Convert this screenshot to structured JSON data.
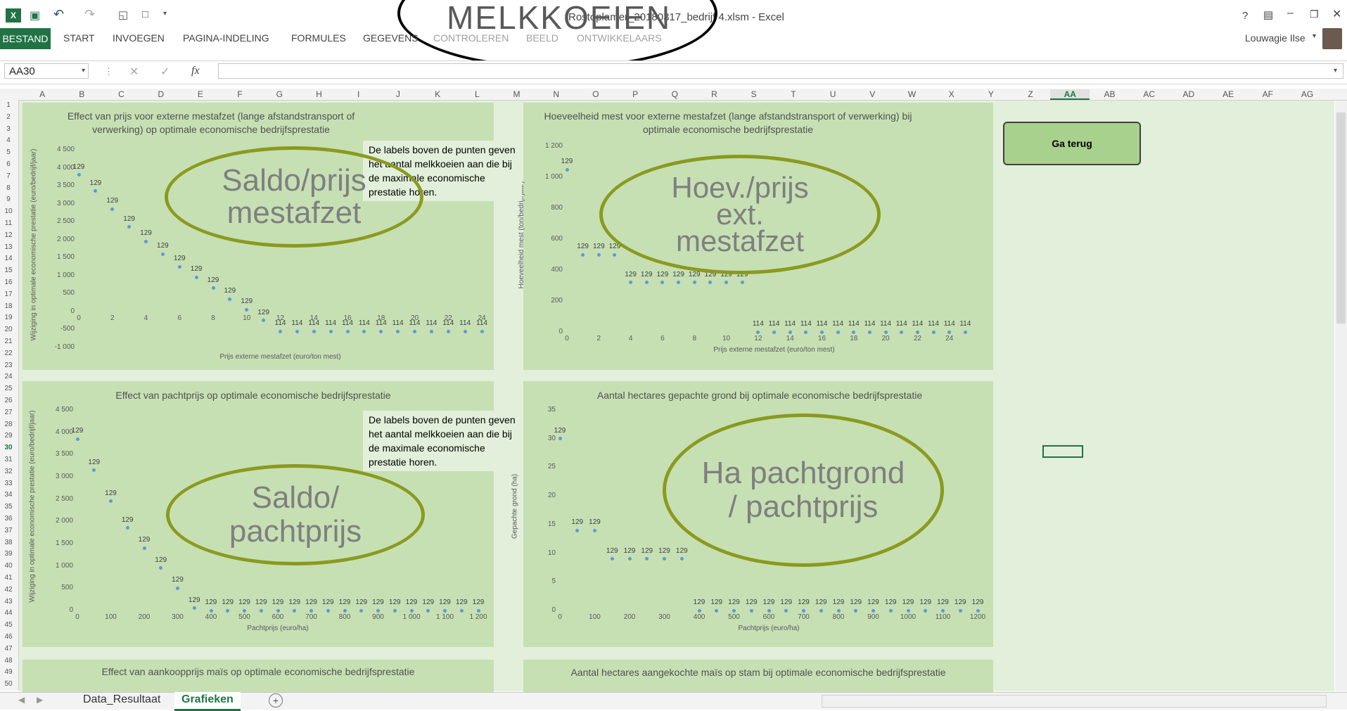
{
  "window": {
    "title": "Rostoplamer_20180317_bedrijf 4.xlsm - Excel",
    "overlay_label": "MELKKOEIEN",
    "user": "Louwagie Ilse",
    "help": "?"
  },
  "ribbon": {
    "tabs": [
      "BESTAND",
      "START",
      "INVOEGEN",
      "PAGINA-INDELING",
      "FORMULES",
      "GEGEVENS",
      "CONTROLEREN",
      "BEELD",
      "ONTWIKKELAARS"
    ]
  },
  "formula_bar": {
    "namebox": "AA30",
    "fx": "fx",
    "value": ""
  },
  "columns": [
    "A",
    "B",
    "C",
    "D",
    "E",
    "F",
    "G",
    "H",
    "I",
    "J",
    "K",
    "L",
    "M",
    "N",
    "O",
    "P",
    "Q",
    "R",
    "S",
    "T",
    "U",
    "V",
    "W",
    "X",
    "Y",
    "Z",
    "AA",
    "AB",
    "AC",
    "AD",
    "AE",
    "AF",
    "AG"
  ],
  "rows": [
    "1",
    "2",
    "3",
    "4",
    "5",
    "6",
    "7",
    "8",
    "9",
    "10",
    "11",
    "12",
    "13",
    "14",
    "15",
    "16",
    "17",
    "18",
    "19",
    "20",
    "21",
    "22",
    "23",
    "24",
    "25",
    "26",
    "27",
    "28",
    "29",
    "30",
    "31",
    "32",
    "33",
    "34",
    "35",
    "36",
    "37",
    "38",
    "39",
    "40",
    "41",
    "42",
    "43",
    "44",
    "45",
    "46",
    "47",
    "48",
    "49",
    "50"
  ],
  "note_text": "De labels boven de punten geven het aantal melkkoeien aan die bij de maximale economische prestatie horen.",
  "ellipses": {
    "e1": "Saldo/prijs mestafzet",
    "e2": "Hoev./prijs ext. mestafzet",
    "e3": "Saldo/ pachtprijs",
    "e4": "Ha pachtgrond / pachtprijs"
  },
  "button": {
    "label": "Ga terug"
  },
  "sheets": {
    "tab1": "Data_Resultaat",
    "tab2": "Grafieken",
    "add": "+"
  },
  "bottom_titles": {
    "t5": "Effect van aankoopprijs maïs op optimale economische bedrijfsprestatie",
    "t6": "Aantal hectares aangekochte maïs op stam bij optimale economische bedrijfsprestatie"
  },
  "chart_data": [
    {
      "type": "scatter",
      "title": "Effect van prijs voor externe mestafzet (lange afstandstransport of verwerking) op optimale economische bedrijfsprestatie",
      "xlabel": "Prijs externe mestafzet (euro/ton mest)",
      "ylabel": "Wijziging in optimale economische prestatie (euro/bedrijf/jaar)",
      "xlim": [
        0,
        24
      ],
      "ylim": [
        -1000,
        4500
      ],
      "xticks": [
        "0",
        "2",
        "4",
        "6",
        "8",
        "10",
        "12",
        "14",
        "16",
        "18",
        "20",
        "22",
        "24"
      ],
      "yticks": [
        "-1 000",
        "-500",
        "0",
        "500",
        "1 000",
        "1 500",
        "2 000",
        "2 500",
        "3 000",
        "3 500",
        "4 000",
        "4 500"
      ],
      "x": [
        0,
        1,
        2,
        3,
        4,
        5,
        6,
        7,
        8,
        9,
        10,
        11,
        12,
        13,
        14,
        15,
        16,
        17,
        18,
        19,
        20,
        21,
        22,
        23,
        24
      ],
      "y": [
        3800,
        3350,
        2850,
        2350,
        1950,
        1600,
        1250,
        950,
        650,
        350,
        50,
        -250,
        -550,
        -550,
        -550,
        -550,
        -550,
        -550,
        -550,
        -550,
        -550,
        -550,
        -550,
        -550,
        -550
      ],
      "labels": [
        "129",
        "129",
        "129",
        "129",
        "129",
        "129",
        "129",
        "129",
        "129",
        "129",
        "129",
        "129",
        "114",
        "114",
        "114",
        "114",
        "114",
        "114",
        "114",
        "114",
        "114",
        "114",
        "114",
        "114",
        "114"
      ]
    },
    {
      "type": "scatter",
      "title": "Hoeveelheid mest voor externe mestafzet (lange afstandstransport of verwerking) bij optimale economische bedrijfsprestatie",
      "xlabel": "Prijs externe mestafzet (euro/ton mest)",
      "ylabel": "Hoeveelheid mest (ton/bedrijf/jaar)",
      "xlim": [
        0,
        26
      ],
      "ylim": [
        0,
        1200
      ],
      "xticks": [
        "0",
        "2",
        "4",
        "6",
        "8",
        "10",
        "12",
        "14",
        "16",
        "18",
        "20",
        "22",
        "24"
      ],
      "yticks": [
        "0",
        "200",
        "400",
        "600",
        "800",
        "1 000",
        "1 200"
      ],
      "x": [
        0,
        1,
        2,
        3,
        4,
        5,
        6,
        7,
        8,
        9,
        10,
        11,
        12,
        13,
        14,
        15,
        16,
        17,
        18,
        19,
        20,
        21,
        22,
        23,
        24,
        25
      ],
      "y": [
        1050,
        500,
        500,
        500,
        320,
        320,
        320,
        320,
        320,
        320,
        320,
        320,
        0,
        0,
        0,
        0,
        0,
        0,
        0,
        0,
        0,
        0,
        0,
        0,
        0,
        0
      ],
      "labels": [
        "129",
        "129",
        "129",
        "129",
        "129",
        "129",
        "129",
        "129",
        "129",
        "129",
        "129",
        "129",
        "114",
        "114",
        "114",
        "114",
        "114",
        "114",
        "114",
        "114",
        "114",
        "114",
        "114",
        "114",
        "114",
        "114"
      ]
    },
    {
      "type": "scatter",
      "title": "Effect van pachtprijs op optimale economische bedrijfsprestatie",
      "xlabel": "Pachtprijs (euro/ha)",
      "ylabel": "Wijziging in optimale economische prestatie (euro/bedrijf/jaar)",
      "xlim": [
        0,
        1200
      ],
      "ylim": [
        0,
        4500
      ],
      "xticks": [
        "0",
        "100",
        "200",
        "300",
        "400",
        "500",
        "600",
        "700",
        "800",
        "900",
        "1 000",
        "1 100",
        "1 200"
      ],
      "yticks": [
        "0",
        "500",
        "1 000",
        "1 500",
        "2 000",
        "2 500",
        "3 000",
        "3 500",
        "4 000",
        "4 500"
      ],
      "x": [
        0,
        50,
        100,
        150,
        200,
        250,
        300,
        350,
        400,
        450,
        500,
        550,
        600,
        650,
        700,
        750,
        800,
        850,
        900,
        950,
        1000,
        1050,
        1100,
        1150,
        1200
      ],
      "y": [
        3850,
        3150,
        2450,
        1850,
        1400,
        950,
        500,
        50,
        0,
        0,
        0,
        0,
        0,
        0,
        0,
        0,
        0,
        0,
        0,
        0,
        0,
        0,
        0,
        0,
        0
      ],
      "labels": [
        "129",
        "129",
        "129",
        "129",
        "129",
        "129",
        "129",
        "129",
        "129",
        "129",
        "129",
        "129",
        "129",
        "129",
        "129",
        "129",
        "129",
        "129",
        "129",
        "129",
        "129",
        "129",
        "129",
        "129",
        "129"
      ]
    },
    {
      "type": "scatter",
      "title": "Aantal hectares gepachte grond bij optimale economische bedrijfsprestatie",
      "xlabel": "Pachtprijs (euro/ha)",
      "ylabel": "Gepachte grond (ha)",
      "xlim": [
        0,
        1200
      ],
      "ylim": [
        0,
        35
      ],
      "xticks": [
        "0",
        "100",
        "200",
        "300",
        "400",
        "500",
        "600",
        "700",
        "800",
        "900",
        "1000",
        "1100",
        "1200"
      ],
      "yticks": [
        "0",
        "5",
        "10",
        "15",
        "20",
        "25",
        "30",
        "35"
      ],
      "x": [
        0,
        50,
        100,
        150,
        200,
        250,
        300,
        350,
        400,
        450,
        500,
        550,
        600,
        650,
        700,
        750,
        800,
        850,
        900,
        950,
        1000,
        1050,
        1100,
        1150,
        1200
      ],
      "y": [
        30,
        14,
        14,
        9,
        9,
        9,
        9,
        9,
        0,
        0,
        0,
        0,
        0,
        0,
        0,
        0,
        0,
        0,
        0,
        0,
        0,
        0,
        0,
        0,
        0
      ],
      "labels": [
        "129",
        "129",
        "129",
        "129",
        "129",
        "129",
        "129",
        "129",
        "129",
        "129",
        "129",
        "129",
        "129",
        "129",
        "129",
        "129",
        "129",
        "129",
        "129",
        "129",
        "129",
        "129",
        "129",
        "129",
        "129"
      ]
    }
  ]
}
